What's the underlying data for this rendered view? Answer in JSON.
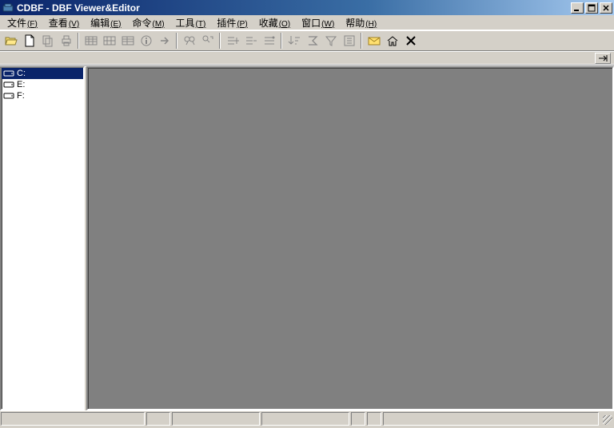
{
  "window": {
    "title": "CDBF - DBF Viewer&Editor"
  },
  "menu": {
    "file": {
      "label": "文件",
      "mnemonic": "(F)"
    },
    "view": {
      "label": "查看",
      "mnemonic": "(V)"
    },
    "edit": {
      "label": "编辑",
      "mnemonic": "(E)"
    },
    "cmd": {
      "label": "命令",
      "mnemonic": "(M)"
    },
    "tools": {
      "label": "工具",
      "mnemonic": "(T)"
    },
    "plugin": {
      "label": "插件",
      "mnemonic": "(P)"
    },
    "fav": {
      "label": "收藏",
      "mnemonic": "(O)"
    },
    "window": {
      "label": "窗口",
      "mnemonic": "(W)"
    },
    "help": {
      "label": "帮助",
      "mnemonic": "(H)"
    }
  },
  "drives": {
    "items": [
      {
        "label": "C:"
      },
      {
        "label": "E:"
      },
      {
        "label": "F:"
      }
    ]
  }
}
